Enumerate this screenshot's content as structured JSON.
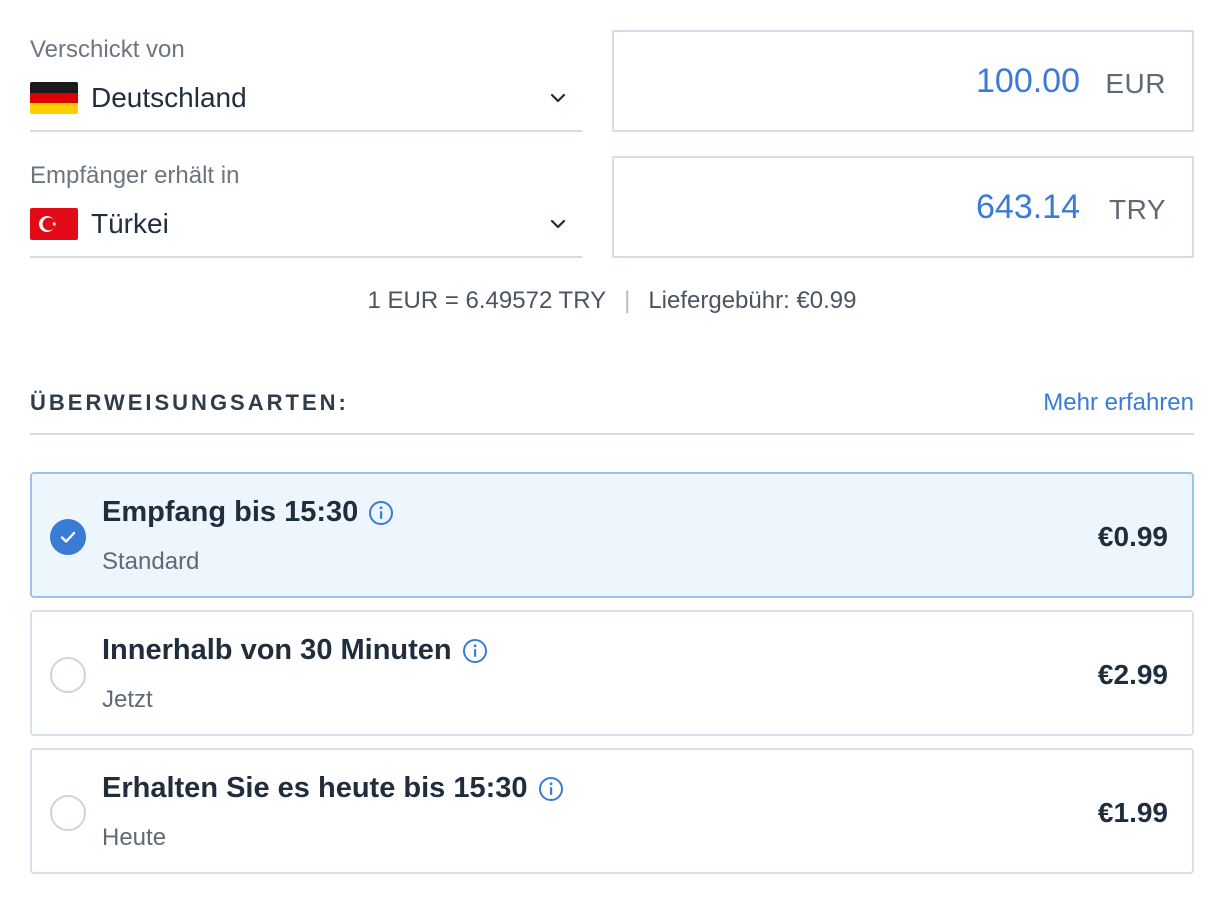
{
  "sender": {
    "label": "Verschickt von",
    "country": "Deutschland",
    "amount": "100.00",
    "currency": "EUR"
  },
  "recipient": {
    "label": "Empfänger erhält in",
    "country": "Türkei",
    "amount": "643.14",
    "currency": "TRY"
  },
  "rate": {
    "exchange": "1 EUR = 6.49572 TRY",
    "separator": "|",
    "fee": "Liefergebühr: €0.99"
  },
  "transfer_types": {
    "title": "ÜBERWEISUNGSARTEN:",
    "learn_more": "Mehr erfahren",
    "options": [
      {
        "title": "Empfang bis 15:30",
        "subtitle": "Standard",
        "price": "€0.99",
        "selected": true
      },
      {
        "title": "Innerhalb von 30 Minuten",
        "subtitle": "Jetzt",
        "price": "€2.99",
        "selected": false
      },
      {
        "title": "Erhalten Sie es heute bis 15:30",
        "subtitle": "Heute",
        "price": "€1.99",
        "selected": false
      }
    ]
  },
  "colors": {
    "accent": "#3a7bd5",
    "selected_background": "#edf5fd",
    "border": "#d3dbe3"
  }
}
